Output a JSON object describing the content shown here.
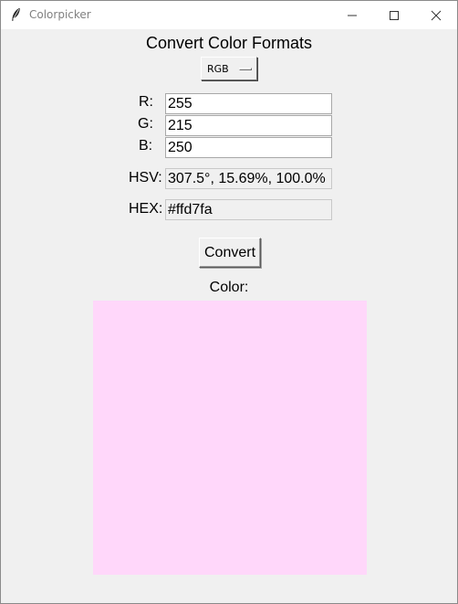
{
  "window": {
    "title": "Colorpicker"
  },
  "header": {
    "title": "Convert Color Formats"
  },
  "format_menu": {
    "selected": "RGB"
  },
  "fields": {
    "r": {
      "label": "R:",
      "value": "255"
    },
    "g": {
      "label": "G:",
      "value": "215"
    },
    "b": {
      "label": "B:",
      "value": "250"
    },
    "hsv": {
      "label": "HSV:",
      "value": "307.5°, 15.69%, 100.0%"
    },
    "hex": {
      "label": "HEX:",
      "value": "#ffd7fa"
    }
  },
  "convert_button": {
    "label": "Convert"
  },
  "preview": {
    "label": "Color:",
    "color": "#ffd7fa"
  },
  "icons": {
    "app": "feather-icon",
    "minimize": "minimize-icon",
    "maximize": "maximize-icon",
    "close": "close-icon"
  }
}
